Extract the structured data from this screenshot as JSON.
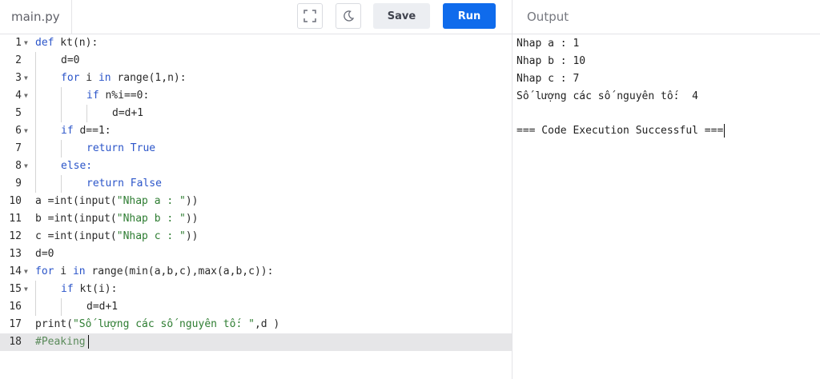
{
  "header": {
    "file_tab": "main.py",
    "fullscreen_icon": "fullscreen-icon",
    "theme_icon": "moon-icon",
    "save_label": "Save",
    "run_label": "Run",
    "output_label": "Output",
    "accent_color": "#0f6bec"
  },
  "editor": {
    "lines": [
      {
        "n": "1",
        "fold": true
      },
      {
        "n": "2",
        "fold": false
      },
      {
        "n": "3",
        "fold": true
      },
      {
        "n": "4",
        "fold": true
      },
      {
        "n": "5",
        "fold": false
      },
      {
        "n": "6",
        "fold": true
      },
      {
        "n": "7",
        "fold": false
      },
      {
        "n": "8",
        "fold": true
      },
      {
        "n": "9",
        "fold": false
      },
      {
        "n": "10",
        "fold": false
      },
      {
        "n": "11",
        "fold": false
      },
      {
        "n": "12",
        "fold": false
      },
      {
        "n": "13",
        "fold": false
      },
      {
        "n": "14",
        "fold": true
      },
      {
        "n": "15",
        "fold": true
      },
      {
        "n": "16",
        "fold": false
      },
      {
        "n": "17",
        "fold": false
      },
      {
        "n": "18",
        "fold": false
      }
    ],
    "code": {
      "l1_def": "def",
      "l1_rest": " kt(n):",
      "l2": "d=0",
      "l3_for": "for",
      "l3_i": " i ",
      "l3_in": "in",
      "l3_rest": " range(1,n):",
      "l4_if": "if",
      "l4_rest": " n%i==0:",
      "l5": "d=d+1",
      "l6_if": "if",
      "l6_rest": " d==1:",
      "l7_ret": "return",
      "l7_val": " True",
      "l8": "else:",
      "l9_ret": "return",
      "l9_val": " False",
      "l10_pre": "a =int(input(",
      "l10_str": "\"Nhap a : \"",
      "l10_post": "))",
      "l11_pre": "b =int(input(",
      "l11_str": "\"Nhap b : \"",
      "l11_post": "))",
      "l12_pre": "c =int(input(",
      "l12_str": "\"Nhap c : \"",
      "l12_post": "))",
      "l13": "d=0",
      "l14_for": "for",
      "l14_i": " i ",
      "l14_in": "in",
      "l14_rest": " range(min(a,b,c),max(a,b,c)):",
      "l15_if": "if",
      "l15_rest": " kt(i):",
      "l16": "d=d+1",
      "l17_pre": "print(",
      "l17_str": "\"Số lượng các số nguyên tố: \"",
      "l17_post": ",d )",
      "l18": "#Peaking"
    }
  },
  "output": {
    "lines": [
      "Nhap a : 1",
      "Nhap b : 10",
      "Nhap c : 7",
      "Số lượng các số nguyên tố:  4",
      "",
      "=== Code Execution Successful ==="
    ]
  }
}
